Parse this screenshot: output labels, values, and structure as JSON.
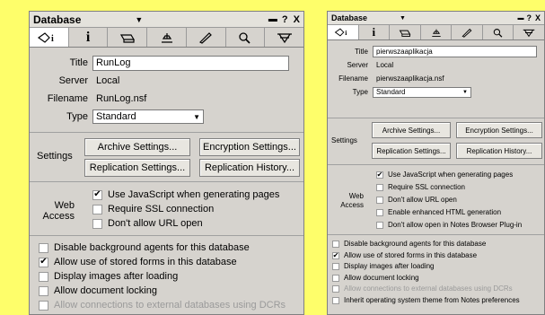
{
  "left": {
    "title": "Database",
    "title_arrow": "▼",
    "controls": {
      "min": "▬",
      "help": "?",
      "close": "X"
    },
    "basics": {
      "title_label": "Title",
      "title_value": "RunLog",
      "server_label": "Server",
      "server_value": "Local",
      "filename_label": "Filename",
      "filename_value": "RunLog.nsf",
      "type_label": "Type",
      "type_value": "Standard"
    },
    "settings": {
      "label": "Settings",
      "archive": "Archive Settings...",
      "encryption": "Encryption Settings...",
      "replication": "Replication Settings...",
      "history": "Replication History..."
    },
    "web": {
      "label1": "Web",
      "label2": "Access",
      "items": [
        {
          "text": "Use JavaScript when generating pages",
          "checked": true
        },
        {
          "text": "Require SSL connection",
          "checked": false
        },
        {
          "text": "Don't allow URL open",
          "checked": false
        }
      ]
    },
    "options": [
      {
        "text": "Disable background agents for this database",
        "checked": false,
        "disabled": false
      },
      {
        "text": "Allow use of stored forms in this database",
        "checked": true,
        "disabled": false
      },
      {
        "text": "Display images after loading",
        "checked": false,
        "disabled": false
      },
      {
        "text": "Allow document locking",
        "checked": false,
        "disabled": false
      },
      {
        "text": "Allow connections to external databases using DCRs",
        "checked": false,
        "disabled": true
      }
    ]
  },
  "right": {
    "title": "Database",
    "title_arrow": "▼",
    "controls": {
      "min": "▬",
      "help": "?",
      "close": "X"
    },
    "basics": {
      "title_label": "Title",
      "title_value": "pierwszaaplikacja",
      "server_label": "Server",
      "server_value": "Local",
      "filename_label": "Filename",
      "filename_value": "pierwszaaplikacja.nsf",
      "type_label": "Type",
      "type_value": "Standard"
    },
    "settings": {
      "label": "Settings",
      "archive": "Archive Settings...",
      "encryption": "Encryption Settings...",
      "replication": "Replication Settings...",
      "history": "Replication History..."
    },
    "web": {
      "label1": "Web",
      "label2": "Access",
      "items": [
        {
          "text": "Use JavaScript when generating pages",
          "checked": true
        },
        {
          "text": "Require SSL connection",
          "checked": false
        },
        {
          "text": "Don't allow URL open",
          "checked": false
        },
        {
          "text": "Enable enhanced HTML generation",
          "checked": false
        },
        {
          "text": "Don't allow open in Notes Browser Plug-in",
          "checked": false
        }
      ]
    },
    "options": [
      {
        "text": "Disable background agents for this database",
        "checked": false,
        "disabled": false
      },
      {
        "text": "Allow use of stored forms in this database",
        "checked": true,
        "disabled": false
      },
      {
        "text": "Display images after loading",
        "checked": false,
        "disabled": false
      },
      {
        "text": "Allow document locking",
        "checked": false,
        "disabled": false
      },
      {
        "text": "Allow connections to external databases using DCRs",
        "checked": false,
        "disabled": true
      },
      {
        "text": "Inherit operating system theme from Notes preferences",
        "checked": false,
        "disabled": false
      }
    ]
  },
  "tabs": [
    {
      "icon": "info-tab-icon",
      "label": "i"
    },
    {
      "icon": "print-tab-icon"
    },
    {
      "icon": "design-tab-icon"
    },
    {
      "icon": "launch-tab-icon"
    },
    {
      "icon": "full-text-index-tab-icon"
    },
    {
      "icon": "advanced-tab-icon"
    }
  ],
  "colors": {
    "background": "#fefe6a",
    "panel": "#d6d3ce"
  }
}
